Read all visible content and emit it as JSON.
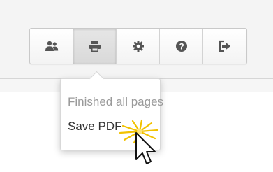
{
  "toolbar": {
    "buttons": [
      {
        "icon": "users-icon",
        "active": false
      },
      {
        "icon": "print-icon",
        "active": true
      },
      {
        "icon": "gear-icon",
        "active": false
      },
      {
        "icon": "help-icon",
        "active": false
      },
      {
        "icon": "sign-out-icon",
        "active": false
      }
    ]
  },
  "print_popover": {
    "status_text": "Finished all pages",
    "action_label": "Save PDF"
  },
  "colors": {
    "icon": "#555555",
    "status_text": "#9a9a9a",
    "action_text": "#333333",
    "click_highlight": "#f2c200"
  }
}
